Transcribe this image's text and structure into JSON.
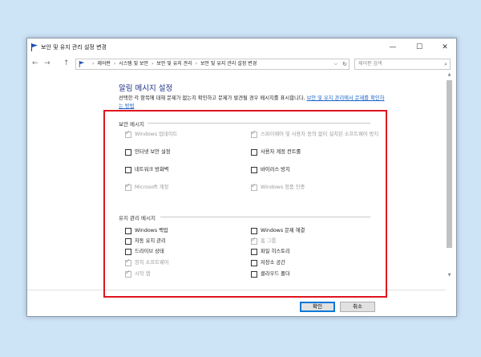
{
  "window": {
    "title": "보안 및 유지 관리 설정 변경"
  },
  "controls": {
    "minimize": "—",
    "maximize": "☐",
    "close": "✕"
  },
  "nav": {
    "back": "←",
    "forward": "→",
    "up": "↑"
  },
  "addressbar": {
    "crumbs": [
      "제어판",
      "시스템 및 보안",
      "보안 및 유지 관리",
      "보안 및 유지 관리 설정 변경"
    ],
    "separator": "›",
    "dropdown": "⌵",
    "refresh": "↻"
  },
  "search": {
    "placeholder": "제어판 검색",
    "icon": "⌕"
  },
  "page": {
    "heading": "알림 메시지 설정",
    "description_text": "선택한 각 항목에 대해 문제가 없는지 확인하고 문제가 발견될 경우 메시지를 표시합니다. ",
    "description_link": "보안 및 유지 관리에서 문제를 확인하는 방법"
  },
  "security": {
    "title": "보안 메시지",
    "items": [
      {
        "label": "Windows 업데이트",
        "checked": true,
        "disabled": true
      },
      {
        "label": "스파이웨어 및 사용자 동의 없이 설치된 소프트웨어 방지",
        "checked": true,
        "disabled": true
      },
      {
        "label": "인터넷 보안 설정",
        "checked": false,
        "disabled": false
      },
      {
        "label": "사용자 계정 컨트롤",
        "checked": false,
        "disabled": false
      },
      {
        "label": "네트워크 방화벽",
        "checked": false,
        "disabled": false
      },
      {
        "label": "바이러스 방지",
        "checked": false,
        "disabled": false
      },
      {
        "label": "Microsoft 계정",
        "checked": true,
        "disabled": true
      },
      {
        "label": "Windows 정품 인증",
        "checked": true,
        "disabled": true
      }
    ]
  },
  "maintenance": {
    "title": "유지 관리 메시지",
    "items": [
      {
        "label": "Windows 백업",
        "checked": false,
        "disabled": false
      },
      {
        "label": "Windows 문제 해결",
        "checked": false,
        "disabled": false
      },
      {
        "label": "자동 유지 관리",
        "checked": false,
        "disabled": false
      },
      {
        "label": "홈 그룹",
        "checked": true,
        "disabled": true
      },
      {
        "label": "드라이브 상태",
        "checked": false,
        "disabled": false
      },
      {
        "label": "파일 히스토리",
        "checked": false,
        "disabled": false
      },
      {
        "label": "장치 소프트웨어",
        "checked": true,
        "disabled": true
      },
      {
        "label": "저장소 공간",
        "checked": false,
        "disabled": false
      },
      {
        "label": "시작 앱",
        "checked": true,
        "disabled": true
      },
      {
        "label": "클라우드 폴더",
        "checked": false,
        "disabled": false
      }
    ]
  },
  "buttons": {
    "ok": "확인",
    "cancel": "취소"
  },
  "colors": {
    "highlight_frame": "#e0141e",
    "heading": "#1e3287",
    "link": "#1a64c8"
  }
}
